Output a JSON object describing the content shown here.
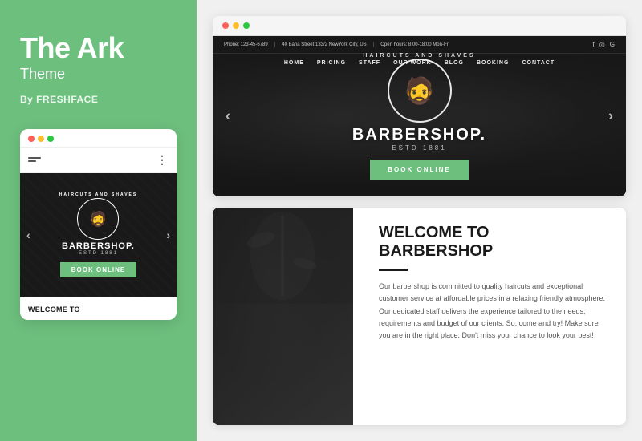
{
  "left": {
    "title": "The Ark",
    "subtitle": "Theme",
    "by": "By FRESHFACE"
  },
  "mobile": {
    "nav": {
      "hamburger_label": "menu",
      "dots_label": "more"
    },
    "hero": {
      "prev": "‹",
      "next": "›",
      "logo_arc": "HAIRCUTS AND SHAVES",
      "logo_name": "BARBERSHOP.",
      "logo_estd": "ESTD 1881"
    },
    "book_btn": "BOOK ONLINE",
    "welcome": "WELCOME TO"
  },
  "desktop": {
    "topbar": {
      "phone": "Phone: 123-45-6789",
      "address": "40 Bana Street 133/2 NewYork City, US",
      "hours": "Open hours: 8:00-18:00 Mon-Fri",
      "socials": [
        "f",
        "o",
        "G"
      ]
    },
    "nav_items": [
      "HOME",
      "PRICING",
      "STAFF",
      "OUR WORK",
      "BLOG",
      "BOOKING",
      "CONTACT"
    ],
    "hero": {
      "prev": "‹",
      "next": "›",
      "logo_arc": "HAIRCUTS AND SHAVES",
      "logo_name": "BARBERSHOP.",
      "logo_estd": "ESTD 1881"
    },
    "book_btn": "BOOK ONLINE"
  },
  "welcome": {
    "heading_line1": "WELCOME TO",
    "heading_line2": "BARBERSHOP",
    "body": "Our barbershop is committed to quality haircuts and exceptional customer service at affordable prices in a relaxing friendly atmosphere. Our dedicated staff delivers the experience tailored to the needs, requirements and budget of our clients. So, come and try! Make sure you are in the right place. Don't miss your chance to look your best!"
  },
  "browser_dots": {
    "red": "#ff5f57",
    "yellow": "#febc2e",
    "green": "#28c840"
  }
}
